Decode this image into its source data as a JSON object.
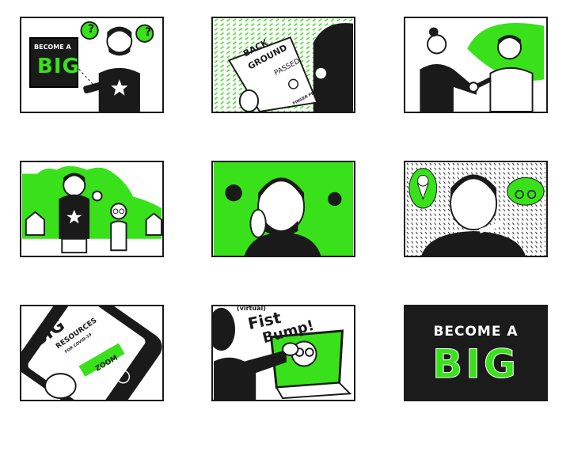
{
  "panels": {
    "p1": {
      "sign_line1": "BECOME A",
      "sign_line2": "BIG",
      "bubble1": "?",
      "bubble2": "?"
    },
    "p2": {
      "doc_title_1": "BACK",
      "doc_title_2": "GROUND",
      "doc_status": "PASSED",
      "doc_footer": "FINGER PRINT"
    },
    "p7": {
      "title": "BIG",
      "subtitle": "RESOURCES",
      "subtitle2": "FOR COVID-19",
      "item_highlight": "ZOOM"
    },
    "p8": {
      "caption_small": "(virtual)",
      "caption_1": "Fist",
      "caption_2": "Bump!"
    },
    "p9": {
      "line1": "BECOME A",
      "line2": "BIG"
    }
  },
  "colors": {
    "accent": "#39e11a",
    "ink": "#1a1a1a"
  }
}
